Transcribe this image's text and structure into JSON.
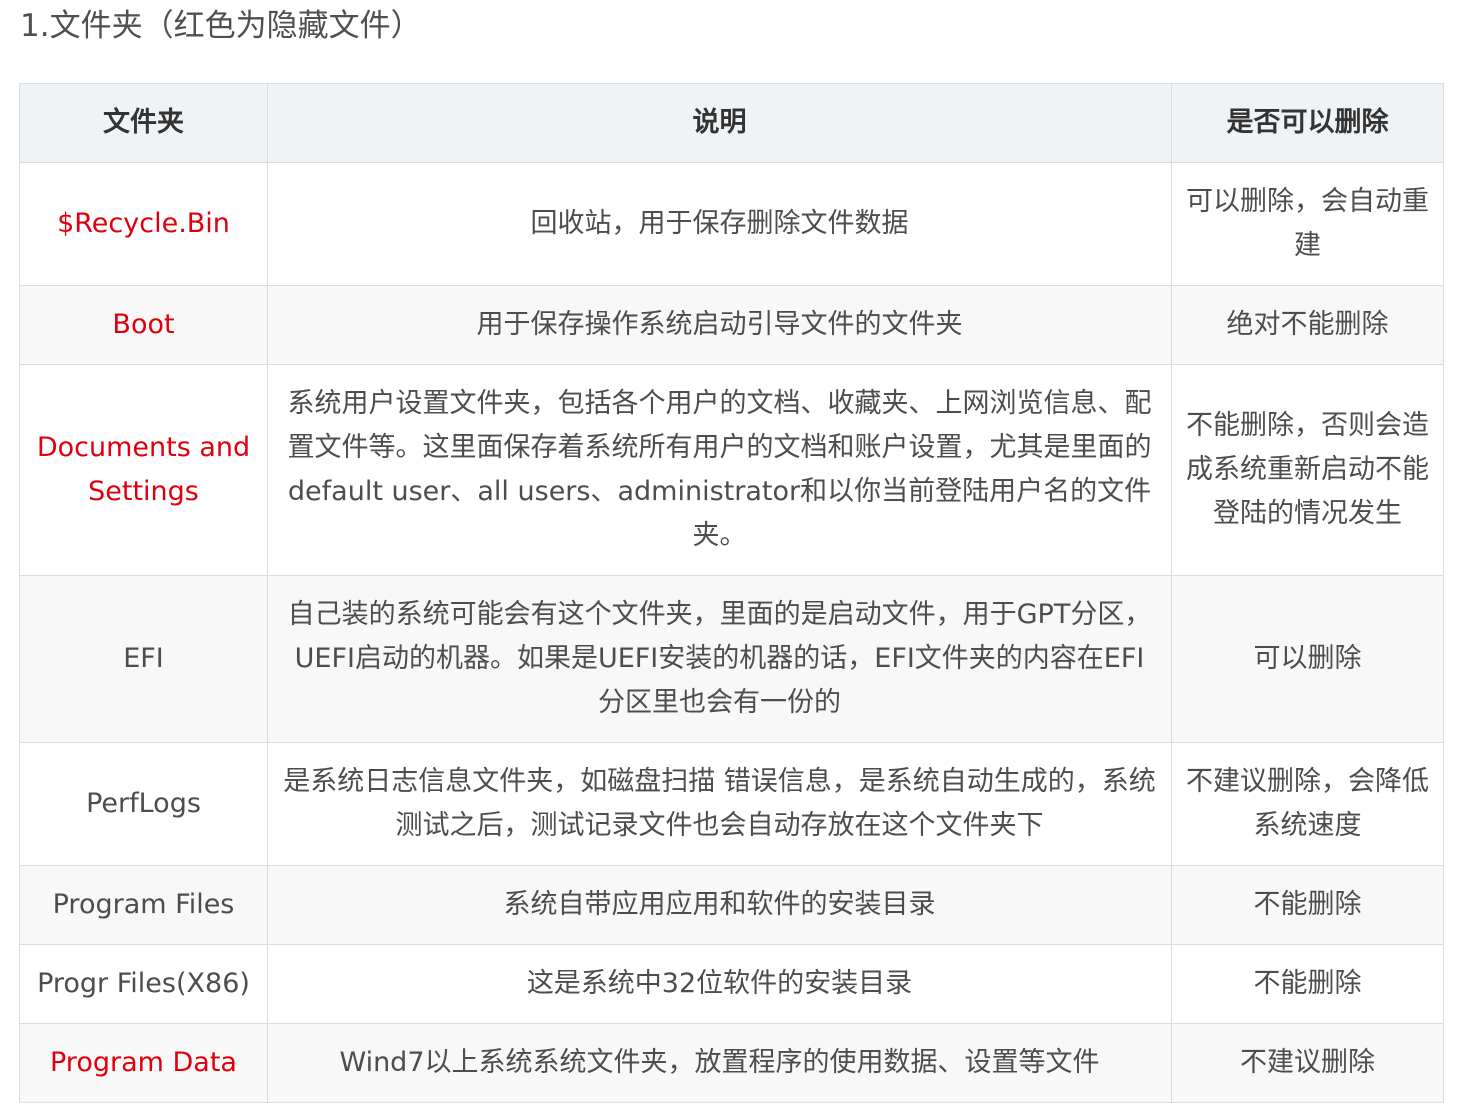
{
  "heading": "1.文件夹（红色为隐藏文件）",
  "table": {
    "headers": [
      "文件夹",
      "说明",
      "是否可以删除"
    ],
    "hidden_color": "#e0000d",
    "rows": [
      {
        "folder": "$Recycle.Bin",
        "hidden": true,
        "description": "回收站，用于保存删除文件数据",
        "deletable": "可以删除，会自动重建"
      },
      {
        "folder": "Boot",
        "hidden": true,
        "description": "用于保存操作系统启动引导文件的文件夹",
        "deletable": "绝对不能删除"
      },
      {
        "folder": "Documents and Settings",
        "hidden": true,
        "description": "系统用户设置文件夹，包括各个用户的文档、收藏夹、上网浏览信息、配置文件等。这里面保存着系统所有用户的文档和账户设置，尤其是里面的default user、all users、administrator和以你当前登陆用户名的文件夹。",
        "deletable": "不能删除，否则会造成系统重新启动不能登陆的情况发生"
      },
      {
        "folder": "EFI",
        "hidden": false,
        "description": "自己装的系统可能会有这个文件夹，里面的是启动文件，用于GPT分区，UEFI启动的机器。如果是UEFI安装的机器的话，EFI文件夹的内容在EFI分区里也会有一份的",
        "deletable": "可以删除"
      },
      {
        "folder": "PerfLogs",
        "hidden": false,
        "description": "是系统日志信息文件夹，如磁盘扫描 错误信息，是系统自动生成的，系统测试之后，测试记录文件也会自动存放在这个文件夹下",
        "deletable": "不建议删除，会降低系统速度"
      },
      {
        "folder": "Program Files",
        "hidden": false,
        "description": "系统自带应用应用和软件的安装目录",
        "deletable": "不能删除"
      },
      {
        "folder": "Progr Files(X86)",
        "hidden": false,
        "description": "这是系统中32位软件的安装目录",
        "deletable": "不能删除"
      },
      {
        "folder": "Program Data",
        "hidden": true,
        "description": "Wind7以上系统系统文件夹，放置程序的使用数据、设置等文件",
        "deletable": "不建议删除"
      }
    ]
  }
}
